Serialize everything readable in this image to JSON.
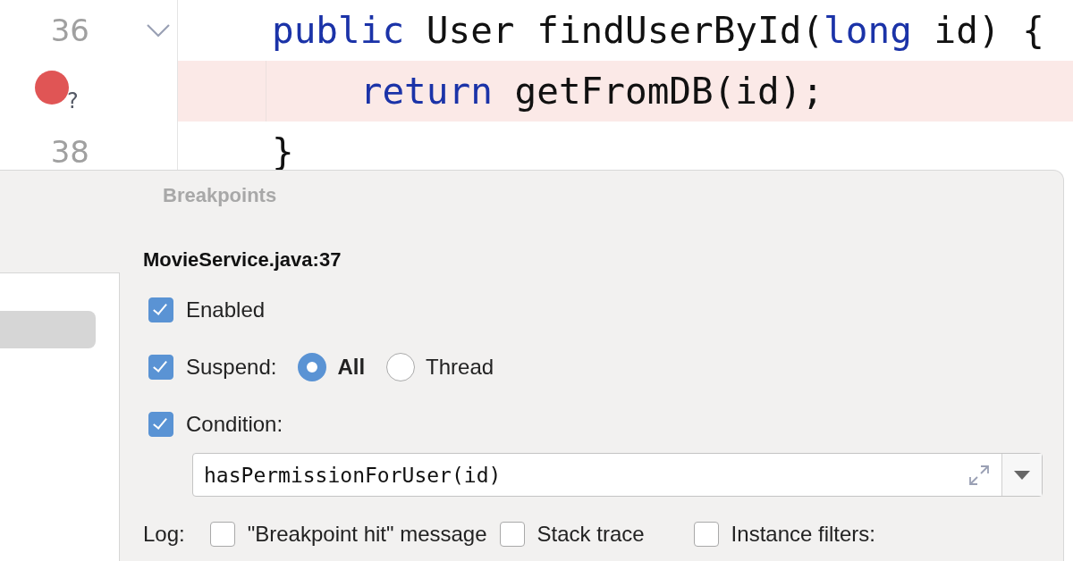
{
  "editor": {
    "lines": [
      {
        "number": "36",
        "fold": true,
        "highlighted": false,
        "tokens": [
          {
            "kind": "keyword",
            "text": "public"
          },
          {
            "kind": "plain",
            "text": " User findUserById("
          },
          {
            "kind": "keyword",
            "text": "long"
          },
          {
            "kind": "plain",
            "text": " id) {"
          }
        ]
      },
      {
        "breakpoint": {
          "badge": "?"
        },
        "highlighted": true,
        "tokens": [
          {
            "kind": "keyword",
            "text": "    return"
          },
          {
            "kind": "plain",
            "text": " getFromDB(id);"
          }
        ]
      },
      {
        "number": "38",
        "fold": false,
        "highlighted": false,
        "tokens": [
          {
            "kind": "plain",
            "text": "}"
          }
        ]
      }
    ]
  },
  "dialog": {
    "title": "Breakpoints",
    "sidebar": {
      "items": [
        {
          "selected": true
        }
      ]
    },
    "header": "MovieService.java:37",
    "options": [
      {
        "kind": "checkbox",
        "label": "Enabled",
        "checked": true
      },
      {
        "kind": "checkbox",
        "label": "Suspend:",
        "checked": true,
        "radios": [
          {
            "label": "All",
            "selected": true
          },
          {
            "label": "Thread",
            "selected": false
          }
        ]
      },
      {
        "kind": "checkbox",
        "label": "Condition:",
        "checked": true
      },
      {
        "kind": "field",
        "value": "hasPermissionForUser(id)"
      },
      {
        "kind": "log",
        "label": "Log:",
        "checks": [
          {
            "label": "\"Breakpoint hit\" message",
            "checked": false
          },
          {
            "label": "Stack trace",
            "checked": false
          }
        ],
        "extra": {
          "label": "Instance filters:",
          "checked": false
        }
      }
    ]
  }
}
